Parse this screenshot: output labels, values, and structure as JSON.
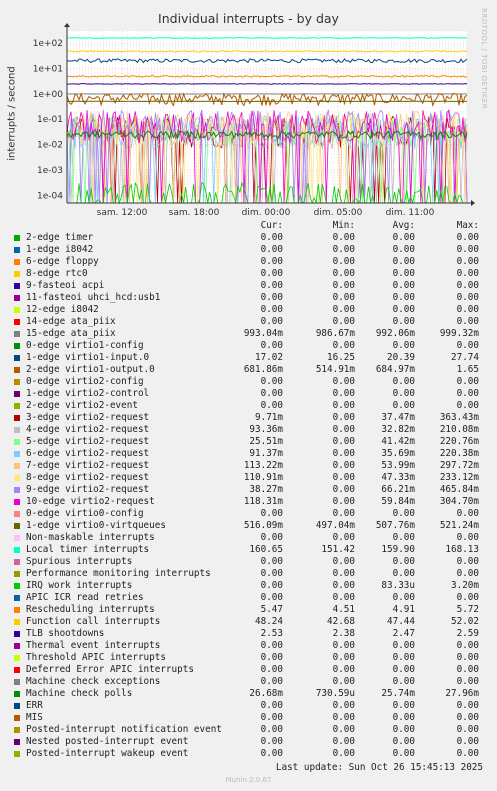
{
  "title": "Individual interrupts - by day",
  "watermark": "RRDTOOL / TOBI OETIKER",
  "columns": {
    "cur": "Cur:",
    "min": "Min:",
    "avg": "Avg:",
    "max": "Max:"
  },
  "last_update": "Last update: Sun Oct 26 15:45:13 2025",
  "version": "Munin 2.0.67",
  "chart_data": {
    "type": "line",
    "title": "Individual interrupts - by day",
    "ylabel": "interrupts / second",
    "yscale": "log",
    "ylim": [
      5e-05,
      300
    ],
    "yticks": [
      "1e+02",
      "1e+01",
      "1e+00",
      "1e-01",
      "1e-02",
      "1e-03",
      "1e-04"
    ],
    "xticks": [
      "sam. 12:00",
      "sam. 18:00",
      "dim. 00:00",
      "dim. 05:00",
      "dim. 11:00"
    ],
    "grid": true,
    "series": [
      {
        "name": "2-edge timer",
        "color": "#00aa00",
        "cur": "0.00",
        "min": "0.00",
        "avg": "0.00",
        "max": "0.00"
      },
      {
        "name": "1-edge i8042",
        "color": "#0066b3",
        "cur": "0.00",
        "min": "0.00",
        "avg": "0.00",
        "max": "0.00"
      },
      {
        "name": "6-edge floppy",
        "color": "#ff8000",
        "cur": "0.00",
        "min": "0.00",
        "avg": "0.00",
        "max": "0.00"
      },
      {
        "name": "8-edge rtc0",
        "color": "#ffcc00",
        "cur": "0.00",
        "min": "0.00",
        "avg": "0.00",
        "max": "0.00"
      },
      {
        "name": "9-fasteoi acpi",
        "color": "#330099",
        "cur": "0.00",
        "min": "0.00",
        "avg": "0.00",
        "max": "0.00"
      },
      {
        "name": "11-fasteoi uhci_hcd:usb1",
        "color": "#990099",
        "cur": "0.00",
        "min": "0.00",
        "avg": "0.00",
        "max": "0.00"
      },
      {
        "name": "12-edge i8042",
        "color": "#ccff00",
        "cur": "0.00",
        "min": "0.00",
        "avg": "0.00",
        "max": "0.00"
      },
      {
        "name": "14-edge ata_piix",
        "color": "#ff0000",
        "cur": "0.00",
        "min": "0.00",
        "avg": "0.00",
        "max": "0.00"
      },
      {
        "name": "15-edge ata_piix",
        "color": "#808080",
        "cur": "993.04m",
        "min": "986.67m",
        "avg": "992.06m",
        "max": "999.32m"
      },
      {
        "name": "0-edge virtio1-config",
        "color": "#008f00",
        "cur": "0.00",
        "min": "0.00",
        "avg": "0.00",
        "max": "0.00"
      },
      {
        "name": "1-edge virtio1-input.0",
        "color": "#00487d",
        "cur": "17.02",
        "min": "16.25",
        "avg": "20.39",
        "max": "27.74"
      },
      {
        "name": "2-edge virtio1-output.0",
        "color": "#b35a00",
        "cur": "681.86m",
        "min": "514.91m",
        "avg": "684.97m",
        "max": "1.65"
      },
      {
        "name": "0-edge virtio2-config",
        "color": "#b38f00",
        "cur": "0.00",
        "min": "0.00",
        "avg": "0.00",
        "max": "0.00"
      },
      {
        "name": "1-edge virtio2-control",
        "color": "#6b006b",
        "cur": "0.00",
        "min": "0.00",
        "avg": "0.00",
        "max": "0.00"
      },
      {
        "name": "2-edge virtio2-event",
        "color": "#8fb300",
        "cur": "0.00",
        "min": "0.00",
        "avg": "0.00",
        "max": "0.00"
      },
      {
        "name": "3-edge virtio2-request",
        "color": "#b30000",
        "cur": "9.71m",
        "min": "0.00",
        "avg": "37.47m",
        "max": "363.43m"
      },
      {
        "name": "4-edge virtio2-request",
        "color": "#bebebe",
        "cur": "93.36m",
        "min": "0.00",
        "avg": "32.82m",
        "max": "210.08m"
      },
      {
        "name": "5-edge virtio2-request",
        "color": "#80ff80",
        "cur": "25.51m",
        "min": "0.00",
        "avg": "41.42m",
        "max": "220.76m"
      },
      {
        "name": "6-edge virtio2-request",
        "color": "#80c9ff",
        "cur": "91.37m",
        "min": "0.00",
        "avg": "35.69m",
        "max": "220.38m"
      },
      {
        "name": "7-edge virtio2-request",
        "color": "#ffc080",
        "cur": "113.22m",
        "min": "0.00",
        "avg": "53.99m",
        "max": "297.72m"
      },
      {
        "name": "8-edge virtio2-request",
        "color": "#ffe680",
        "cur": "110.91m",
        "min": "0.00",
        "avg": "47.33m",
        "max": "233.12m"
      },
      {
        "name": "9-edge virtio2-request",
        "color": "#aa80ff",
        "cur": "38.27m",
        "min": "0.00",
        "avg": "66.21m",
        "max": "465.84m"
      },
      {
        "name": "10-edge virtio2-request",
        "color": "#ee00cc",
        "cur": "118.31m",
        "min": "0.00",
        "avg": "59.84m",
        "max": "304.70m"
      },
      {
        "name": "0-edge virtio0-config",
        "color": "#ff8080",
        "cur": "0.00",
        "min": "0.00",
        "avg": "0.00",
        "max": "0.00"
      },
      {
        "name": "1-edge virtio0-virtqueues",
        "color": "#666600",
        "cur": "516.09m",
        "min": "497.04m",
        "avg": "507.76m",
        "max": "521.24m"
      },
      {
        "name": "Non-maskable interrupts",
        "color": "#ffbfff",
        "cur": "0.00",
        "min": "0.00",
        "avg": "0.00",
        "max": "0.00"
      },
      {
        "name": "Local timer interrupts",
        "color": "#00ffcc",
        "cur": "160.65",
        "min": "151.42",
        "avg": "159.90",
        "max": "168.13"
      },
      {
        "name": "Spurious interrupts",
        "color": "#cc6699",
        "cur": "0.00",
        "min": "0.00",
        "avg": "0.00",
        "max": "0.00"
      },
      {
        "name": "Performance monitoring interrupts",
        "color": "#999900",
        "cur": "0.00",
        "min": "0.00",
        "avg": "0.00",
        "max": "0.00"
      },
      {
        "name": "IRQ work interrupts",
        "color": "#00cc00",
        "cur": "0.00",
        "min": "0.00",
        "avg": "83.33u",
        "max": "3.20m"
      },
      {
        "name": "APIC ICR read retries",
        "color": "#0066b3",
        "cur": "0.00",
        "min": "0.00",
        "avg": "0.00",
        "max": "0.00"
      },
      {
        "name": "Rescheduling interrupts",
        "color": "#ff8000",
        "cur": "5.47",
        "min": "4.51",
        "avg": "4.91",
        "max": "5.72"
      },
      {
        "name": "Function call interrupts",
        "color": "#ffcc00",
        "cur": "48.24",
        "min": "42.68",
        "avg": "47.44",
        "max": "52.02"
      },
      {
        "name": "TLB shootdowns",
        "color": "#330099",
        "cur": "2.53",
        "min": "2.38",
        "avg": "2.47",
        "max": "2.59"
      },
      {
        "name": "Thermal event interrupts",
        "color": "#990099",
        "cur": "0.00",
        "min": "0.00",
        "avg": "0.00",
        "max": "0.00"
      },
      {
        "name": "Threshold APIC interrupts",
        "color": "#ccff00",
        "cur": "0.00",
        "min": "0.00",
        "avg": "0.00",
        "max": "0.00"
      },
      {
        "name": "Deferred Error APIC interrupts",
        "color": "#ff0000",
        "cur": "0.00",
        "min": "0.00",
        "avg": "0.00",
        "max": "0.00"
      },
      {
        "name": "Machine check exceptions",
        "color": "#808080",
        "cur": "0.00",
        "min": "0.00",
        "avg": "0.00",
        "max": "0.00"
      },
      {
        "name": "Machine check polls",
        "color": "#008f00",
        "cur": "26.68m",
        "min": "730.59u",
        "avg": "25.74m",
        "max": "27.96m"
      },
      {
        "name": "ERR",
        "color": "#00487d",
        "cur": "0.00",
        "min": "0.00",
        "avg": "0.00",
        "max": "0.00"
      },
      {
        "name": "MIS",
        "color": "#b35a00",
        "cur": "0.00",
        "min": "0.00",
        "avg": "0.00",
        "max": "0.00"
      },
      {
        "name": "Posted-interrupt notification event",
        "color": "#b38f00",
        "cur": "0.00",
        "min": "0.00",
        "avg": "0.00",
        "max": "0.00"
      },
      {
        "name": "Nested posted-interrupt event",
        "color": "#6b006b",
        "cur": "0.00",
        "min": "0.00",
        "avg": "0.00",
        "max": "0.00"
      },
      {
        "name": "Posted-interrupt wakeup event",
        "color": "#8fb300",
        "cur": "0.00",
        "min": "0.00",
        "avg": "0.00",
        "max": "0.00"
      }
    ]
  }
}
